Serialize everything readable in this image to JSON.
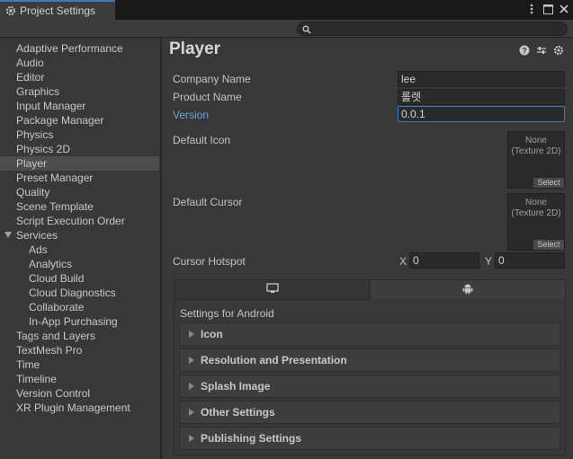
{
  "window": {
    "tab_title": "Project Settings",
    "menu_icon": "kebab-menu-icon",
    "maximize_icon": "maximize-icon",
    "close_icon": "close-icon"
  },
  "search": {
    "placeholder": "",
    "value": ""
  },
  "sidebar": {
    "items": [
      {
        "label": "Adaptive Performance"
      },
      {
        "label": "Audio"
      },
      {
        "label": "Editor"
      },
      {
        "label": "Graphics"
      },
      {
        "label": "Input Manager"
      },
      {
        "label": "Package Manager"
      },
      {
        "label": "Physics"
      },
      {
        "label": "Physics 2D"
      },
      {
        "label": "Player",
        "selected": true
      },
      {
        "label": "Preset Manager"
      },
      {
        "label": "Quality"
      },
      {
        "label": "Scene Template"
      },
      {
        "label": "Script Execution Order"
      },
      {
        "label": "Services",
        "expanded": true
      },
      {
        "label": "Ads",
        "child": true
      },
      {
        "label": "Analytics",
        "child": true
      },
      {
        "label": "Cloud Build",
        "child": true
      },
      {
        "label": "Cloud Diagnostics",
        "child": true
      },
      {
        "label": "Collaborate",
        "child": true
      },
      {
        "label": "In-App Purchasing",
        "child": true
      },
      {
        "label": "Tags and Layers"
      },
      {
        "label": "TextMesh Pro"
      },
      {
        "label": "Time"
      },
      {
        "label": "Timeline"
      },
      {
        "label": "Version Control"
      },
      {
        "label": "XR Plugin Management"
      }
    ]
  },
  "main": {
    "title": "Player",
    "icons": [
      "help-icon",
      "sliders-icon",
      "gear-icon"
    ],
    "company_name": {
      "label": "Company Name",
      "value": "lee"
    },
    "product_name": {
      "label": "Product Name",
      "value": "롤렛"
    },
    "version": {
      "label": "Version",
      "value": "0.0.1"
    },
    "default_icon": {
      "label": "Default Icon",
      "slot_line1": "None",
      "slot_line2": "(Texture 2D)",
      "select": "Select"
    },
    "default_cursor": {
      "label": "Default Cursor",
      "slot_line1": "None",
      "slot_line2": "(Texture 2D)",
      "select": "Select"
    },
    "cursor_hotspot": {
      "label": "Cursor Hotspot",
      "x_label": "X",
      "x_value": "0",
      "y_label": "Y",
      "y_value": "0"
    },
    "platform": {
      "tabs": [
        "monitor-icon",
        "android-icon"
      ],
      "active_tab": "android",
      "settings_for": "Settings for Android",
      "sections": [
        {
          "label": "Icon"
        },
        {
          "label": "Resolution and Presentation"
        },
        {
          "label": "Splash Image"
        },
        {
          "label": "Other Settings"
        },
        {
          "label": "Publishing Settings"
        }
      ]
    }
  },
  "colors": {
    "accent": "#3a79bb",
    "link_label": "#6ca2db",
    "panel_bg": "#383838",
    "selected_row": "#4d4d4d"
  }
}
